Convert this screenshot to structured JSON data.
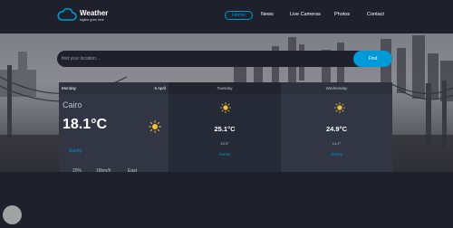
{
  "brand": {
    "title": "Weather",
    "subtitle": "tagline goes here"
  },
  "nav": {
    "items": [
      {
        "label": "Home",
        "active": true
      },
      {
        "label": "News"
      },
      {
        "label": "Live Cameras"
      },
      {
        "label": "Photos"
      },
      {
        "label": "Contact"
      }
    ]
  },
  "search": {
    "placeholder": "find your location...",
    "button": "Find"
  },
  "today": {
    "day": "Monday",
    "date": "6 April",
    "city": "Cairo",
    "temp": "18.1°C",
    "condition": "Sunny",
    "humidity": "20%",
    "wind": "18km/h",
    "direction": "East",
    "icon": "sun-icon"
  },
  "forecast": [
    {
      "day": "Tuesday",
      "temp": "25.1°C",
      "min": "15.9°",
      "condition": "Sunny",
      "icon": "sun-icon"
    },
    {
      "day": "Wednesday",
      "temp": "24.9°C",
      "min": "14.2°",
      "condition": "Sunny",
      "icon": "sun-icon"
    }
  ],
  "colors": {
    "accent": "#009ad8",
    "sun": "#f5c13a",
    "background": "#1e202b",
    "card": "#323544"
  }
}
